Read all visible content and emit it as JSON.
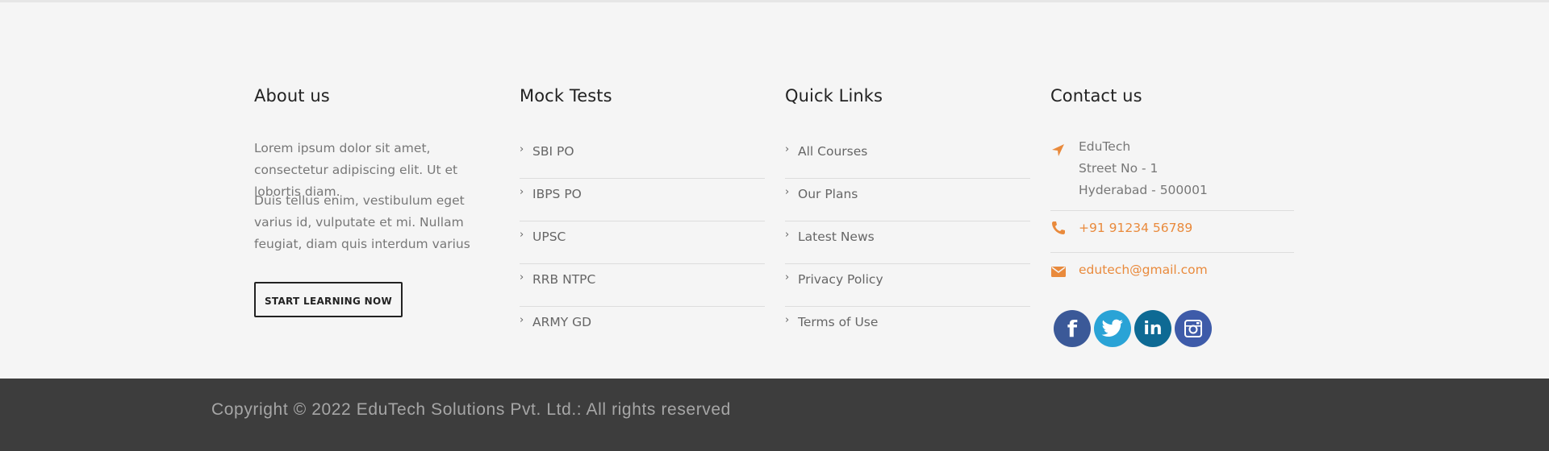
{
  "about": {
    "title": "About us",
    "p1": "Lorem ipsum dolor sit amet, consectetur adipiscing elit. Ut et lobortis diam.",
    "p2": "Duis tellus enim, vestibulum eget varius id, vulputate et mi. Nullam feugiat, diam quis interdum varius",
    "button": "START LEARNING NOW"
  },
  "mock": {
    "title": "Mock Tests",
    "items": [
      "SBI PO",
      "IBPS PO",
      "UPSC",
      "RRB NTPC",
      "ARMY GD"
    ]
  },
  "links": {
    "title": "Quick Links",
    "items": [
      "All Courses",
      "Our Plans",
      "Latest News",
      "Privacy Policy",
      "Terms of Use"
    ]
  },
  "contact": {
    "title": "Contact us",
    "address": [
      "EduTech",
      "Street No - 1",
      "Hyderabad - 500001"
    ],
    "phone": "+91 91234 56789",
    "email": "edutech@gmail.com",
    "social": [
      {
        "name": "facebook-icon",
        "glyph": "f",
        "color": "#3b5998"
      },
      {
        "name": "twitter-icon",
        "glyph": "t",
        "color": "#2aa3d6"
      },
      {
        "name": "linkedin-icon",
        "glyph": "in",
        "color": "#0e6a94"
      },
      {
        "name": "instagram-icon",
        "glyph": "ig",
        "color": "#3e5ba9"
      }
    ]
  },
  "footer": {
    "copyright": "Copyright © 2022 EduTech Solutions Pvt. Ltd.: All rights reserved"
  },
  "colors": {
    "accent": "#e98a3c",
    "bottom_bar": "#3d3d3d"
  }
}
